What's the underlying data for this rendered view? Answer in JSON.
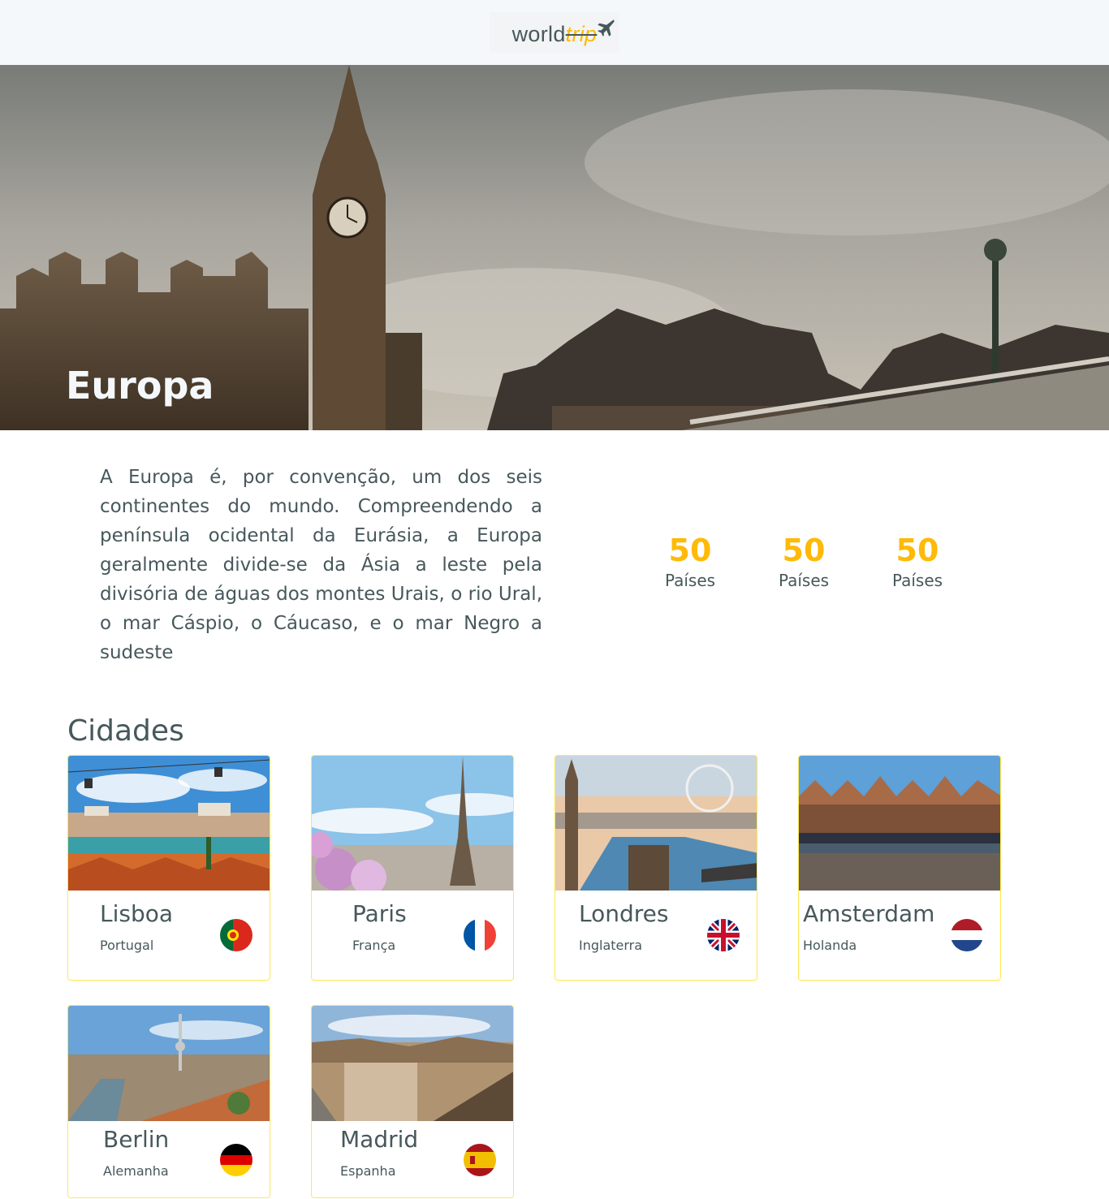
{
  "header": {
    "logo_world": "world",
    "logo_trip": "trip",
    "logo_icon": "airplane-icon"
  },
  "banner": {
    "title": "Europa"
  },
  "info": {
    "description": "A Europa é, por convenção, um dos seis continentes do mundo. Compreendendo a península ocidental da Eurásia, a Europa geralmente divide-se da Ásia a leste pela divisória de águas dos montes Urais, o rio Ural, o mar Cáspio, o Cáucaso, e o mar Negro a sudeste",
    "stats": [
      {
        "number": "50",
        "label": "Países"
      },
      {
        "number": "50",
        "label": "Países"
      },
      {
        "number": "50",
        "label": "Países"
      }
    ]
  },
  "cities": {
    "title": "Cidades",
    "items": [
      {
        "name": "Lisboa",
        "country": "Portugal",
        "flag": "portugal-flag-icon"
      },
      {
        "name": "Paris",
        "country": "França",
        "flag": "france-flag-icon"
      },
      {
        "name": "Londres",
        "country": "Inglaterra",
        "flag": "uk-flag-icon"
      },
      {
        "name": "Amsterdam",
        "country": "Holanda",
        "flag": "netherlands-flag-icon"
      },
      {
        "name": "Berlin",
        "country": "Alemanha",
        "flag": "germany-flag-icon"
      },
      {
        "name": "Madrid",
        "country": "Espanha",
        "flag": "spain-flag-icon"
      }
    ]
  },
  "colors": {
    "accent": "#ffba08",
    "text": "#47585b",
    "header_bg": "#f5f8fa",
    "card_border": "#ffe94d"
  }
}
